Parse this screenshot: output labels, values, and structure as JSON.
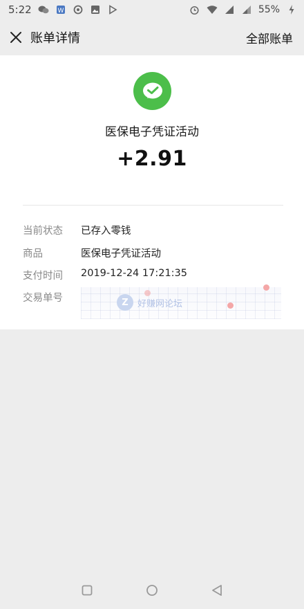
{
  "status_bar": {
    "time": "5:22",
    "battery": "55%",
    "left_icons": [
      "wechat-icon",
      "weibo-icon",
      "netease-icon",
      "image-icon",
      "play-store-icon"
    ],
    "right_icons": [
      "alarm-icon",
      "wifi-icon",
      "signal-icon",
      "signal-icon",
      "charging-icon"
    ]
  },
  "header": {
    "title": "账单详情",
    "right_action": "全部账单"
  },
  "transaction": {
    "merchant": "医保电子凭证活动",
    "amount": "+2.91",
    "logo_color": "#4cbe4a"
  },
  "details": [
    {
      "label": "当前状态",
      "value": "已存入零钱"
    },
    {
      "label": "商品",
      "value": "医保电子凭证活动"
    },
    {
      "label": "支付时间",
      "value": "2019-12-24 17:21:35"
    },
    {
      "label": "交易单号",
      "value": ""
    }
  ],
  "watermark": {
    "logo_letter": "Z",
    "text": "好赚网论坛"
  },
  "colors": {
    "accent": "#4cbe4a",
    "background": "#ededed",
    "card": "#ffffff"
  }
}
